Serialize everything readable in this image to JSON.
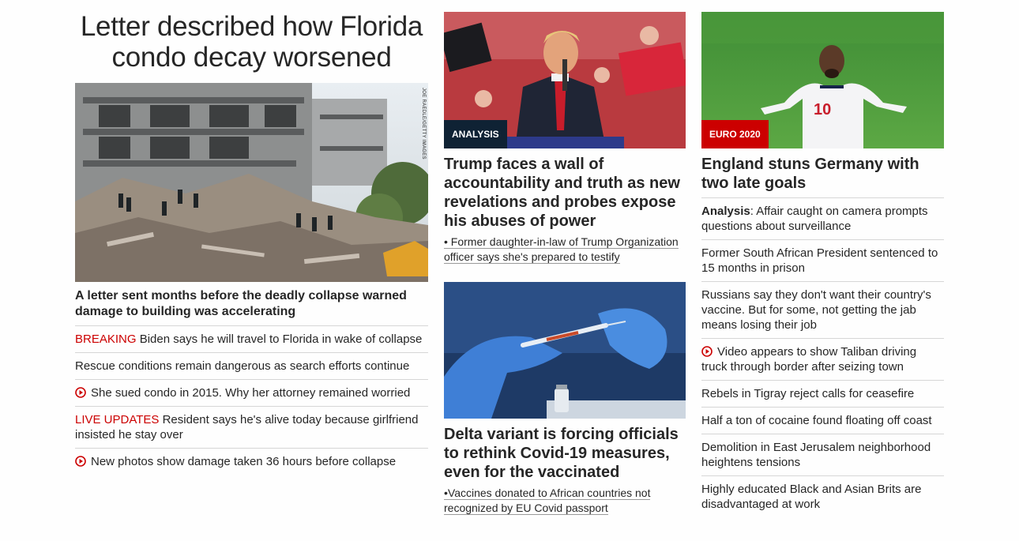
{
  "lead": {
    "headline": "Letter described how Florida condo decay worsened",
    "photo_credit": "JOE RAEDLE/GETTY IMAGES",
    "caption": "A letter sent months before the deadly collapse warned damage to building was accelerating",
    "items": [
      {
        "tag": "BREAKING",
        "text": "Biden says he will travel to Florida in wake of collapse"
      },
      {
        "tag": "",
        "text": "Rescue conditions remain dangerous as search efforts continue"
      },
      {
        "tag": "",
        "video": true,
        "text": "She sued condo in 2015. Why her attorney remained worried"
      },
      {
        "tag": "LIVE UPDATES",
        "text": "Resident says he's alive today because girlfriend insisted he stay over"
      },
      {
        "tag": "",
        "video": true,
        "text": "New photos show damage taken 36 hours before collapse"
      }
    ]
  },
  "middle": {
    "card1": {
      "badge": "ANALYSIS",
      "headline": "Trump faces a wall of accountability and truth as new revelations and probes expose his abuses of power",
      "sub": "• Former daughter-in-law of Trump Organization officer says she's prepared to testify"
    },
    "card2": {
      "headline": "Delta variant is forcing officials to rethink Covid-19 measures, even for the vaccinated",
      "sub": "•Vaccines donated to African countries not recognized by EU Covid passport"
    }
  },
  "right": {
    "badge": "EURO 2020",
    "headline": "England stuns Germany with two late goals",
    "items": [
      {
        "bold": "Analysis",
        "text": ": Affair caught on camera prompts questions about surveillance"
      },
      {
        "text": "Former South African President sentenced to 15 months in prison"
      },
      {
        "text": "Russians say they don't want their country's vaccine. But for some, not getting the jab means losing their job"
      },
      {
        "video": true,
        "text": "Video appears to show Taliban driving truck through border after seizing town"
      },
      {
        "text": "Rebels in Tigray reject calls for ceasefire"
      },
      {
        "text": "Half a ton of cocaine found floating off coast"
      },
      {
        "text": "Demolition in East Jerusalem neighborhood heightens tensions"
      },
      {
        "text": "Highly educated Black and Asian Brits are disadvantaged at work"
      }
    ]
  },
  "colors": {
    "accent_red": "#cc0000",
    "badge_dark": "#0f2234",
    "text": "#262626",
    "divider": "#d6d6d6"
  }
}
